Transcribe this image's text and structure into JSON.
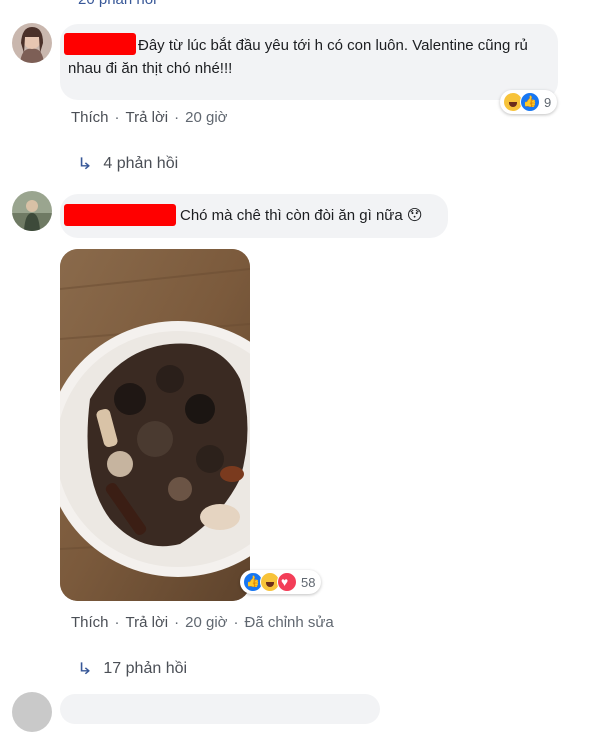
{
  "top_replies_partial": "20 phản hồi",
  "comment1": {
    "text": "Đây từ lúc bắt đầu yêu tới h có con luôn. Valentine cũng rủ nhau đi ăn thịt chó nhé!!!",
    "reactions": {
      "icons": [
        "haha-icon",
        "like-icon"
      ],
      "count": "9"
    },
    "actions": {
      "like": "Thích",
      "reply": "Trả lời",
      "time": "20 giờ"
    },
    "replies": "4 phản hồi"
  },
  "comment2": {
    "text": "Chó mà chê thì còn đòi ăn gì nữa",
    "emoji": "😯",
    "reactions": {
      "icons": [
        "like-icon",
        "haha-icon",
        "love-icon"
      ],
      "count": "58"
    },
    "actions": {
      "like": "Thích",
      "reply": "Trả lời",
      "time": "20 giờ",
      "edited": "Đã chỉnh sửa"
    },
    "replies": "17 phản hồi"
  },
  "colors": {
    "bubble": "#f2f3f5",
    "redaction": "#ff0000",
    "link": "#385898",
    "meta": "#606770"
  }
}
